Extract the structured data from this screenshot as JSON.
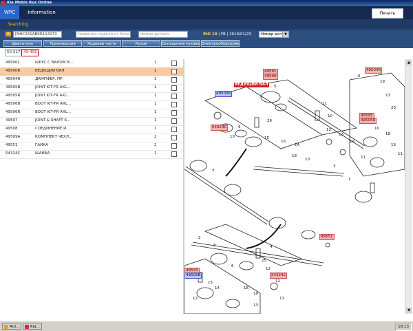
{
  "window": {
    "title": "Kia Mobis Rus Online"
  },
  "header": {
    "tab_wpc": "WPC",
    "tab_info": "Information",
    "print_label": "Печать"
  },
  "status": {
    "searching": "Searching"
  },
  "search": {
    "vin_value": "[NHC241ABKR114270",
    "model_placeholder": "Название модели от Ката",
    "part_placeholder": "Номер детали",
    "select_value": "Номер дет",
    "plus_label": "+"
  },
  "vehicle": {
    "model": "RIO 18",
    "fb": "FB",
    "date": "2019/01/23"
  },
  "categories": [
    "Двигатель",
    "Трансмиссия",
    "Ходовая часть",
    "Кузов",
    "Оснащение кузова",
    "Электрооборудован"
  ],
  "groups": [
    "50-517",
    "43-493"
  ],
  "parts": [
    {
      "code": "49500L",
      "name": "ШРУС С ВАЛОМ В...",
      "qty": "1"
    },
    {
      "code": "49500R",
      "name": "ВЕДУЩИЙ ВАЛ",
      "qty": "1"
    },
    {
      "code": "49504R",
      "name": "ДАМПФЕР, ПР.",
      "qty": "1"
    },
    {
      "code": "49505B",
      "name": "JOINT KIT-FR AXL...",
      "qty": "1"
    },
    {
      "code": "49505R",
      "name": "JOINT KIT-FR AXL...",
      "qty": "1"
    },
    {
      "code": "49506B",
      "name": "BOOT KIT-FR AXL...",
      "qty": "1"
    },
    {
      "code": "49506R",
      "name": "BOOT KIT-FR AXL...",
      "qty": "1"
    },
    {
      "code": "49507",
      "name": "JOINT & SHAFT K...",
      "qty": "1"
    },
    {
      "code": "49508",
      "name": "СОЕДИНЕНИЕ И...",
      "qty": "1"
    },
    {
      "code": "49509A",
      "name": "КОМПЛЕКТ ЧЕХЛ...",
      "qty": "2"
    },
    {
      "code": "49551",
      "name": "ГАЙКА",
      "qty": "2"
    },
    {
      "code": "54324C",
      "name": "ШАЙБА",
      "qty": "1"
    }
  ],
  "diagram": {
    "selected_label": "ВЕДУЩИЙ ВАЛ",
    "callouts": {
      "c49591": "49591",
      "c49506": "49506",
      "c49500R": "49500R",
      "c54324C_a": "54324C",
      "c49504R": "49504R",
      "c49595": "49595",
      "c49505R": "49505R",
      "c49551": "49551",
      "c49593": "49593",
      "c49505B": "49505B",
      "c54324C_b": "54324C"
    },
    "numbers": [
      "5",
      "11",
      "10",
      "12",
      "13",
      "19",
      "26",
      "9",
      "10",
      "15",
      "16",
      "14",
      "18",
      "10",
      "6",
      "19",
      "13",
      "20",
      "3",
      "1",
      "2",
      "25",
      "12",
      "6",
      "15",
      "14",
      "18",
      "10",
      "12",
      "11",
      "12",
      "13",
      "8",
      "7",
      "4",
      "11",
      "10",
      "18",
      "16",
      "11"
    ]
  },
  "taskbar": {
    "task1": "Aut...",
    "task2": "Kia...",
    "clock": "18:13"
  }
}
